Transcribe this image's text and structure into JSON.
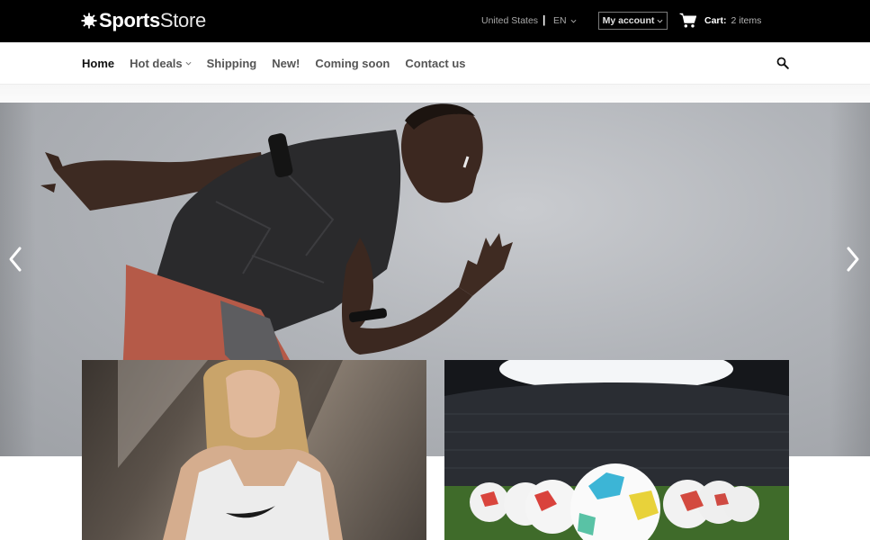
{
  "brand": {
    "name_bold": "Sports",
    "name_light": "Store",
    "logo_icon": "sunburst-logo-icon"
  },
  "topbar": {
    "region": "United States",
    "separator": "|",
    "language": "EN",
    "account_label": "My account",
    "cart_label": "Cart:",
    "cart_count": "2 items"
  },
  "nav": {
    "items": [
      {
        "label": "Home",
        "active": true
      },
      {
        "label": "Hot deals",
        "dropdown": true
      },
      {
        "label": "Shipping"
      },
      {
        "label": "New!"
      },
      {
        "label": "Coming soon"
      },
      {
        "label": "Contact us"
      }
    ],
    "search_icon": "search-icon"
  },
  "hero": {
    "prev_icon": "chevron-left-icon",
    "next_icon": "chevron-right-icon"
  },
  "promos": [
    {
      "name": "promo-tile-sportswear"
    },
    {
      "name": "promo-tile-footballs"
    }
  ],
  "colors": {
    "topbar_bg": "#000000",
    "nav_text": "#555555",
    "nav_active": "#111111",
    "accent_white": "#ffffff"
  }
}
